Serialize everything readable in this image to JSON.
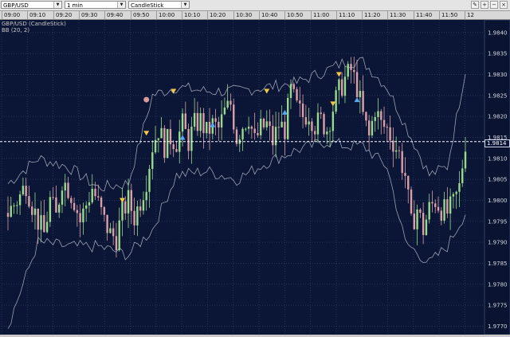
{
  "toolbar": {
    "symbol": "GBP/USD",
    "interval": "1 min",
    "chart_type": "CandleStick",
    "tool_icons": [
      "pencil-icon",
      "zoom-in-icon",
      "zoom-out-icon",
      "close-icon"
    ]
  },
  "time_labels": [
    "09:00",
    "09:10",
    "09:20",
    "09:30",
    "09:40",
    "09:50",
    "10:00",
    "10:10",
    "10:20",
    "10:30",
    "10:40",
    "10:50",
    "11:00",
    "11:10",
    "11:20",
    "11:30",
    "11:40",
    "11:50",
    "12"
  ],
  "header": {
    "instrument": "GBP/USD (CandleStick)",
    "indicator": "BB (20, 2)"
  },
  "colors": {
    "background": "#0b1535",
    "up_candle": "#98d98e",
    "down_candle": "#d9a0a8",
    "bands": "#bfc6d6",
    "grid": "#25345a"
  },
  "chart_data": {
    "type": "candlestick",
    "symbol": "GBP/USD",
    "interval": "1 min",
    "price_axis_labels": [
      "1.9840",
      "1.9835",
      "1.9830",
      "1.9825",
      "1.9820",
      "1.9815",
      "1.9810",
      "1.9805",
      "1.9800",
      "1.9795",
      "1.9790",
      "1.9785",
      "1.9780",
      "1.9775",
      "1.9770"
    ],
    "ylim": [
      1.9768,
      1.9843
    ],
    "current_price": "1.9814",
    "indicator": "BB (20, 2)",
    "close_waypoints": [
      [
        0,
        1.9797
      ],
      [
        4,
        1.9801
      ],
      [
        6,
        1.9804
      ],
      [
        8,
        1.9799
      ],
      [
        10,
        1.9795
      ],
      [
        12,
        1.9792
      ],
      [
        14,
        1.98
      ],
      [
        16,
        1.9796
      ],
      [
        18,
        1.9805
      ],
      [
        20,
        1.9803
      ],
      [
        22,
        1.98
      ],
      [
        24,
        1.9795
      ],
      [
        26,
        1.9799
      ],
      [
        28,
        1.9803
      ],
      [
        30,
        1.9799
      ],
      [
        32,
        1.9795
      ],
      [
        34,
        1.9792
      ],
      [
        36,
        1.9791
      ],
      [
        38,
        1.9797
      ],
      [
        40,
        1.98
      ],
      [
        42,
        1.9796
      ],
      [
        44,
        1.98
      ],
      [
        46,
        1.9805
      ],
      [
        48,
        1.9813
      ],
      [
        50,
        1.9817
      ],
      [
        52,
        1.9813
      ],
      [
        54,
        1.9815
      ],
      [
        56,
        1.9814
      ],
      [
        58,
        1.9818
      ],
      [
        60,
        1.9814
      ],
      [
        62,
        1.9818
      ],
      [
        64,
        1.9819
      ],
      [
        66,
        1.9816
      ],
      [
        68,
        1.9818
      ],
      [
        70,
        1.9817
      ],
      [
        72,
        1.9821
      ],
      [
        74,
        1.9823
      ],
      [
        76,
        1.9815
      ],
      [
        78,
        1.9818
      ],
      [
        80,
        1.982
      ],
      [
        82,
        1.9814
      ],
      [
        84,
        1.9817
      ],
      [
        86,
        1.9818
      ],
      [
        88,
        1.9814
      ],
      [
        90,
        1.9818
      ],
      [
        92,
        1.9817
      ],
      [
        94,
        1.9826
      ],
      [
        96,
        1.9822
      ],
      [
        98,
        1.982
      ],
      [
        100,
        1.9821
      ],
      [
        102,
        1.9818
      ],
      [
        104,
        1.9819
      ],
      [
        106,
        1.9817
      ],
      [
        108,
        1.9822
      ],
      [
        110,
        1.9826
      ],
      [
        112,
        1.9829
      ],
      [
        114,
        1.9831
      ],
      [
        116,
        1.9827
      ],
      [
        118,
        1.982
      ],
      [
        120,
        1.9815
      ],
      [
        122,
        1.9822
      ],
      [
        124,
        1.9818
      ],
      [
        126,
        1.9817
      ],
      [
        128,
        1.9814
      ],
      [
        130,
        1.9811
      ],
      [
        132,
        1.9806
      ],
      [
        134,
        1.9794
      ],
      [
        136,
        1.9798
      ],
      [
        138,
        1.9793
      ],
      [
        140,
        1.9798
      ],
      [
        142,
        1.98
      ],
      [
        144,
        1.9798
      ],
      [
        146,
        1.9797
      ],
      [
        148,
        1.9799
      ],
      [
        150,
        1.9803
      ],
      [
        152,
        1.9814
      ]
    ],
    "bands_upper": [
      [
        0,
        1.9804
      ],
      [
        10,
        1.981
      ],
      [
        20,
        1.9808
      ],
      [
        30,
        1.9803
      ],
      [
        40,
        1.9804
      ],
      [
        48,
        1.9825
      ],
      [
        56,
        1.9827
      ],
      [
        66,
        1.9826
      ],
      [
        76,
        1.9826
      ],
      [
        86,
        1.9827
      ],
      [
        96,
        1.9828
      ],
      [
        106,
        1.9831
      ],
      [
        112,
        1.9833
      ],
      [
        118,
        1.9833
      ],
      [
        126,
        1.9827
      ],
      [
        132,
        1.9818
      ],
      [
        140,
        1.9806
      ],
      [
        146,
        1.9808
      ],
      [
        152,
        1.9831
      ]
    ],
    "bands_lower": [
      [
        0,
        1.977
      ],
      [
        10,
        1.979
      ],
      [
        20,
        1.9789
      ],
      [
        30,
        1.9789
      ],
      [
        40,
        1.9787
      ],
      [
        48,
        1.9793
      ],
      [
        56,
        1.9806
      ],
      [
        66,
        1.9807
      ],
      [
        76,
        1.9805
      ],
      [
        86,
        1.9809
      ],
      [
        96,
        1.9812
      ],
      [
        106,
        1.9814
      ],
      [
        112,
        1.9813
      ],
      [
        118,
        1.9813
      ],
      [
        126,
        1.9808
      ],
      [
        132,
        1.979
      ],
      [
        140,
        1.9785
      ],
      [
        146,
        1.9789
      ],
      [
        152,
        1.9797
      ]
    ],
    "markers": [
      {
        "type": "dot",
        "at": 46,
        "price": 1.9824
      },
      {
        "type": "down",
        "at": 38,
        "price": 1.98
      },
      {
        "type": "down",
        "at": 46,
        "price": 1.9816
      },
      {
        "type": "down",
        "at": 55,
        "price": 1.9826
      },
      {
        "type": "up",
        "at": 58,
        "price": 1.9815
      },
      {
        "type": "up",
        "at": 68,
        "price": 1.9818
      },
      {
        "type": "down",
        "at": 86,
        "price": 1.9826
      },
      {
        "type": "up",
        "at": 92,
        "price": 1.9821
      },
      {
        "type": "down",
        "at": 108,
        "price": 1.9823
      },
      {
        "type": "down",
        "at": 110,
        "price": 1.983
      },
      {
        "type": "up",
        "at": 116,
        "price": 1.9824
      }
    ]
  }
}
